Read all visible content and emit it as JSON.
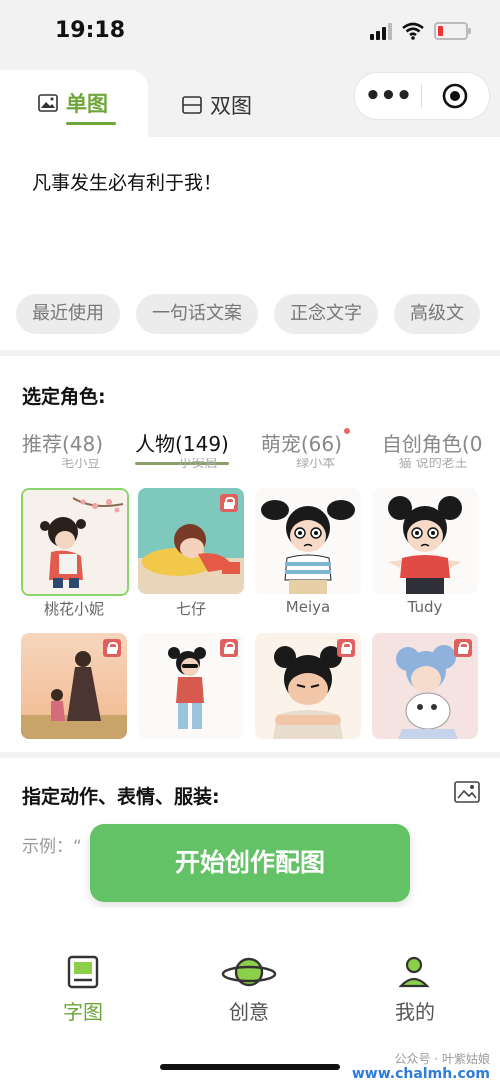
{
  "status": {
    "time": "19:18"
  },
  "tabs": {
    "single": "单图",
    "double": "双图"
  },
  "input": {
    "text": "凡事发生必有利于我！"
  },
  "chips": [
    "最近使用",
    "一句话文案",
    "正念文字",
    "高级文"
  ],
  "characters": {
    "section_title": "选定角色:",
    "category_tabs": [
      "推荐(48)",
      "人物(149)",
      "萌宠(66)",
      "自创角色(0"
    ],
    "clipped_names": [
      "毛小豆",
      "小安启",
      "绿小本",
      "猫 说的老王"
    ],
    "row1": [
      {
        "name": "桃花小妮",
        "selected": true,
        "locked": false
      },
      {
        "name": "七仔",
        "selected": false,
        "locked": true
      },
      {
        "name": "Meiya",
        "selected": false,
        "locked": false
      },
      {
        "name": "Tudy",
        "selected": false,
        "locked": false
      }
    ],
    "row2_locked": [
      true,
      true,
      true,
      true
    ]
  },
  "action": {
    "title": "指定动作、表情、服装:",
    "example": "示例：“",
    "start_button": "开始创作配图"
  },
  "nav": {
    "items": [
      "字图",
      "创意",
      "我的"
    ],
    "active": "字图"
  },
  "watermark": {
    "line1": "公众号 · 叶紫姑娘",
    "line2": "www.chalmh.com"
  },
  "colors": {
    "accent": "#6ea63a",
    "button": "#62c265",
    "lock": "#e06060"
  }
}
